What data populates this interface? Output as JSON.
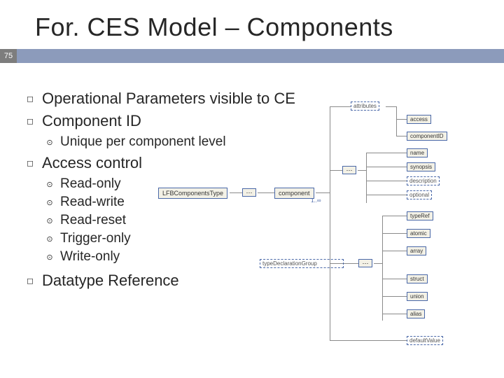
{
  "page_number": "75",
  "title": "For. CES Model – Components",
  "bullets": [
    {
      "text": "Operational Parameters visible to CE"
    },
    {
      "text": "Component ID",
      "children": [
        {
          "text": "Unique per component level"
        }
      ]
    },
    {
      "text": "Access control",
      "children": [
        {
          "text": "Read-only"
        },
        {
          "text": "Read-write"
        },
        {
          "text": "Read-reset"
        },
        {
          "text": "Trigger-only"
        },
        {
          "text": "Write-only"
        }
      ]
    },
    {
      "text": "Datatype Reference"
    }
  ],
  "diagram": {
    "root_label": "LFBComponentsType",
    "seq1": "···",
    "component_label": "component",
    "component_mult": "1..∞",
    "attr_group_label": "attributes",
    "access_label": "access",
    "componentID_label": "componentID",
    "seq2": "···",
    "name_label": "name",
    "synopsis_label": "synopsis",
    "description_label": "description",
    "optional_label": "optional",
    "seq3": "···",
    "typeRef_label": "typeRef",
    "atomic_label": "atomic",
    "array_label": "array",
    "typeDecl_label": "typeDeclarationGroup",
    "struct_label": "struct",
    "union_label": "union",
    "alias_label": "alias",
    "defaultValue_label": "defaultValue"
  }
}
